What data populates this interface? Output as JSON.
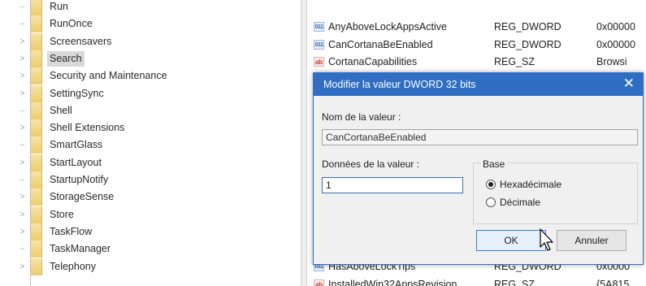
{
  "tree": {
    "items": [
      {
        "label": "Run",
        "twist": "",
        "selected": false
      },
      {
        "label": "RunOnce",
        "twist": "",
        "selected": false
      },
      {
        "label": "Screensavers",
        "twist": ">",
        "selected": false
      },
      {
        "label": "Search",
        "twist": ">",
        "selected": true
      },
      {
        "label": "Security and Maintenance",
        "twist": ">",
        "selected": false
      },
      {
        "label": "SettingSync",
        "twist": ">",
        "selected": false
      },
      {
        "label": "Shell",
        "twist": "",
        "selected": false
      },
      {
        "label": "Shell Extensions",
        "twist": ">",
        "selected": false
      },
      {
        "label": "SmartGlass",
        "twist": "",
        "selected": false
      },
      {
        "label": "StartLayout",
        "twist": ">",
        "selected": false
      },
      {
        "label": "StartupNotify",
        "twist": "",
        "selected": false
      },
      {
        "label": "StorageSense",
        "twist": ">",
        "selected": false
      },
      {
        "label": "Store",
        "twist": ">",
        "selected": false
      },
      {
        "label": "TaskFlow",
        "twist": ">",
        "selected": false
      },
      {
        "label": "TaskManager",
        "twist": "",
        "selected": false
      },
      {
        "label": "Telephony",
        "twist": ">",
        "selected": false
      }
    ]
  },
  "values": {
    "rows": [
      {
        "icon": "dword-value-icon",
        "name": "AnyAboveLockAppsActive",
        "type": "REG_DWORD",
        "data": "0x00000"
      },
      {
        "icon": "dword-value-icon",
        "name": "CanCortanaBeEnabled",
        "type": "REG_DWORD",
        "data": "0x00000"
      },
      {
        "icon": "string-value-icon",
        "name": "CortanaCapabilities",
        "type": "REG_SZ",
        "data": "Browsi"
      }
    ],
    "bottom_rows": [
      {
        "icon": "dword-value-icon",
        "name": "HasAboveLockTips",
        "type": "REG_DWORD",
        "data": "0x0000"
      },
      {
        "icon": "string-value-icon",
        "name": "InstalledWin32AppsRevision",
        "type": "REG_SZ",
        "data": "{5A815"
      }
    ]
  },
  "dialog": {
    "title": "Modifier la valeur DWORD 32 bits",
    "close_glyph": "✕",
    "name_label": "Nom de la valeur :",
    "name_value": "CanCortanaBeEnabled",
    "data_label": "Données de la valeur :",
    "data_value": "1",
    "base_label": "Base",
    "base_options": [
      {
        "label": "Hexadécimale",
        "checked": true
      },
      {
        "label": "Décimale",
        "checked": false
      }
    ],
    "ok_label": "OK",
    "cancel_label": "Annuler"
  },
  "colors": {
    "titlebar": "#2f6ec3",
    "folder": "#eccd6d",
    "selection": "#d9d9d9"
  }
}
